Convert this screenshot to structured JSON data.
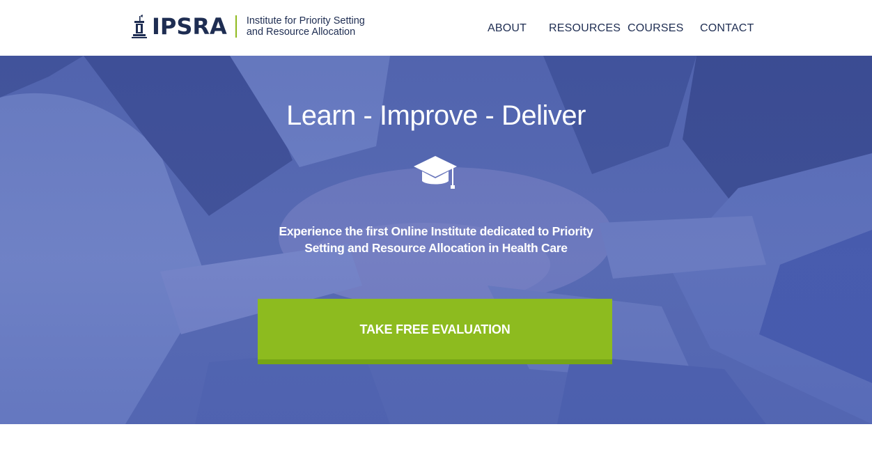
{
  "header": {
    "logo": {
      "wordmark": "IPSRA",
      "tagline_line1": "Institute for Priority Setting",
      "tagline_line2": "and Resource Allocation",
      "brand_color": "#1e2d52",
      "accent_color": "#8fba1e"
    },
    "nav": [
      {
        "label": "ABOUT"
      },
      {
        "label": "RESOURCES"
      },
      {
        "label": "COURSES"
      },
      {
        "label": "CONTACT"
      }
    ]
  },
  "hero": {
    "title": "Learn - Improve - Deliver",
    "icon": "graduation-cap-icon",
    "subtitle_line1": "Experience the first Online Institute dedicated to Priority",
    "subtitle_line2": "Setting and Resource Allocation in Health Care",
    "cta_label": "TAKE FREE EVALUATION",
    "cta_color": "#8dbb1f",
    "background_image": "stacked-hands-teamwork-photo"
  }
}
